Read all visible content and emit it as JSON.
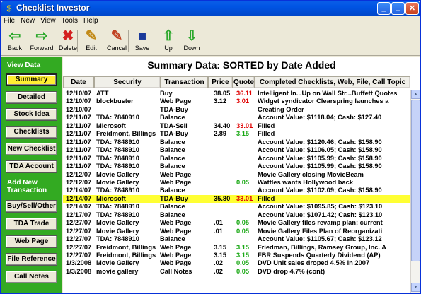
{
  "window": {
    "title": "Checklist Investor"
  },
  "menu": [
    "File",
    "New",
    "View",
    "Tools",
    "Help"
  ],
  "toolbar": [
    {
      "label": "Back",
      "icon": "arrow-left-icon",
      "glyph": "⇦",
      "color": "#2ba82b"
    },
    {
      "label": "Forward",
      "icon": "arrow-right-icon",
      "glyph": "⇨",
      "color": "#2ba82b"
    },
    {
      "label": "Delete",
      "icon": "delete-x-icon",
      "glyph": "✖",
      "color": "#d32020"
    },
    {
      "label": "Edit",
      "icon": "edit-pencil-icon",
      "glyph": "✎",
      "color": "#c28a18"
    },
    {
      "label": "Cancel",
      "icon": "cancel-icon",
      "glyph": "✎",
      "color": "#c04020"
    },
    {
      "label": "Save",
      "icon": "save-disk-icon",
      "glyph": "■",
      "color": "#1a3a9a"
    },
    {
      "label": "Up",
      "icon": "arrow-up-icon",
      "glyph": "⇧",
      "color": "#2ba82b"
    },
    {
      "label": "Down",
      "icon": "arrow-down-icon",
      "glyph": "⇩",
      "color": "#2ba82b"
    }
  ],
  "sidebar": {
    "view_heading": "View Data",
    "view_buttons": [
      "Summary",
      "Detailed",
      "Stock Idea",
      "Checklists",
      "New Checklist",
      "TDA Account"
    ],
    "active": "Summary",
    "add_heading_1": "Add New",
    "add_heading_2": "Transaction",
    "add_buttons": [
      "Buy/Sell/Other",
      "TDA Trade",
      "Web Page",
      "File Reference",
      "Call Notes"
    ]
  },
  "main": {
    "title": "Summary Data: SORTED by Date Added",
    "columns": [
      "Date",
      "Security",
      "Transaction",
      "Price",
      "Quote",
      "Completed Checklists, Web, File, Call Topic"
    ],
    "rows": [
      {
        "date": "12/10/07",
        "security": "ATT",
        "transaction": "Buy",
        "price": "38.05",
        "quote": "36.11",
        "quote_dir": "down",
        "topic": "Intelligent In...Up on Wall Str...Buffett Quotes"
      },
      {
        "date": "12/10/07",
        "security": "blockbuster",
        "transaction": "Web Page",
        "price": "3.12",
        "quote": "3.01",
        "quote_dir": "down",
        "topic": "Widget syndicator Clearspring launches a"
      },
      {
        "date": "12/10/07",
        "security": "",
        "transaction": "TDA-Buy",
        "price": "",
        "quote": "",
        "quote_dir": "",
        "topic": "Creating Order"
      },
      {
        "date": "12/11/07",
        "security": "TDA: 7840910",
        "transaction": "Balance",
        "price": "",
        "quote": "",
        "quote_dir": "",
        "topic": "Account Value: $1118.04; Cash: $127.40"
      },
      {
        "date": "12/11/07",
        "security": "Microsoft",
        "transaction": "TDA-Sell",
        "price": "34.40",
        "quote": "33.01",
        "quote_dir": "down",
        "topic": "Filled"
      },
      {
        "date": "12/11/07",
        "security": "Freidmont, Billings,",
        "transaction": "TDA-Buy",
        "price": "2.89",
        "quote": "3.15",
        "quote_dir": "up",
        "topic": "Filled"
      },
      {
        "date": "12/11/07",
        "security": "TDA: 7848910",
        "transaction": "Balance",
        "price": "",
        "quote": "",
        "quote_dir": "",
        "topic": "Account Value: $1120.46; Cash: $158.90"
      },
      {
        "date": "12/11/07",
        "security": "TDA: 7848910",
        "transaction": "Balance",
        "price": "",
        "quote": "",
        "quote_dir": "",
        "topic": "Account Value: $1106.05; Cash: $158.90"
      },
      {
        "date": "12/11/07",
        "security": "TDA: 7848910",
        "transaction": "Balance",
        "price": "",
        "quote": "",
        "quote_dir": "",
        "topic": "Account Value: $1105.99; Cash: $158.90"
      },
      {
        "date": "12/11/07",
        "security": "TDA: 7848910",
        "transaction": "Balance",
        "price": "",
        "quote": "",
        "quote_dir": "",
        "topic": "Account Value: $1105.99; Cash: $158.90"
      },
      {
        "date": "12/12/07",
        "security": "Movie Gallery",
        "transaction": "Web Page",
        "price": "",
        "quote": "",
        "quote_dir": "",
        "topic": "Movie Gallery closing MovieBeam"
      },
      {
        "date": "12/12/07",
        "security": "Movie Gallery",
        "transaction": "Web Page",
        "price": "",
        "quote": "0.05",
        "quote_dir": "up",
        "topic": "Wattles wants Hollywood back"
      },
      {
        "date": "12/14/07",
        "security": "TDA: 7848910",
        "transaction": "Balance",
        "price": "",
        "quote": "",
        "quote_dir": "",
        "topic": "Account Value: $1102.09; Cash: $158.90"
      },
      {
        "date": "12/14/07",
        "security": "Microsoft",
        "transaction": "TDA-Buy",
        "price": "35.80",
        "quote": "33.01",
        "quote_dir": "down",
        "topic": "Filled",
        "highlight": true
      },
      {
        "date": "12/14/07",
        "security": "TDA: 7848910",
        "transaction": "Balance",
        "price": "",
        "quote": "",
        "quote_dir": "",
        "topic": "Account Value: $1095.85; Cash: $123.10"
      },
      {
        "date": "12/17/07",
        "security": "TDA: 7848910",
        "transaction": "Balance",
        "price": "",
        "quote": "",
        "quote_dir": "",
        "topic": "Account Value: $1071.42; Cash: $123.10"
      },
      {
        "date": "12/27/07",
        "security": "Movie Gallery",
        "transaction": "Web Page",
        "price": ".01",
        "quote": "0.05",
        "quote_dir": "up",
        "topic": "Movie Gallery files revamp plan; current"
      },
      {
        "date": "12/27/07",
        "security": "Movie Gallery",
        "transaction": "Web Page",
        "price": ".01",
        "quote": "0.05",
        "quote_dir": "up",
        "topic": "Movie Gallery Files Plan of Reorganizati"
      },
      {
        "date": "12/27/07",
        "security": "TDA: 7848910",
        "transaction": "Balance",
        "price": "",
        "quote": "",
        "quote_dir": "",
        "topic": "Account Value: $1105.67; Cash: $123.12"
      },
      {
        "date": "12/27/07",
        "security": "Freidmont, Billings,",
        "transaction": "Web Page",
        "price": "3.15",
        "quote": "3.15",
        "quote_dir": "up",
        "topic": "Friedman, Billings, Ramsey Group, Inc. A"
      },
      {
        "date": "12/27/07",
        "security": "Freidmont, Billings,",
        "transaction": "Web Page",
        "price": "3.15",
        "quote": "3.15",
        "quote_dir": "up",
        "topic": "FBR Suspends Quarterly Dividend (AP)"
      },
      {
        "date": "1/3/2008",
        "security": "Movie Gallery",
        "transaction": "Web Page",
        "price": ".02",
        "quote": "0.05",
        "quote_dir": "up",
        "topic": "DVD Unit sales droped 4.5% in 2007"
      },
      {
        "date": "1/3/2008",
        "security": "movie gallery",
        "transaction": "Call Notes",
        "price": ".02",
        "quote": "0.05",
        "quote_dir": "up",
        "topic": "DVD drop 4.7% (cont)"
      }
    ]
  }
}
